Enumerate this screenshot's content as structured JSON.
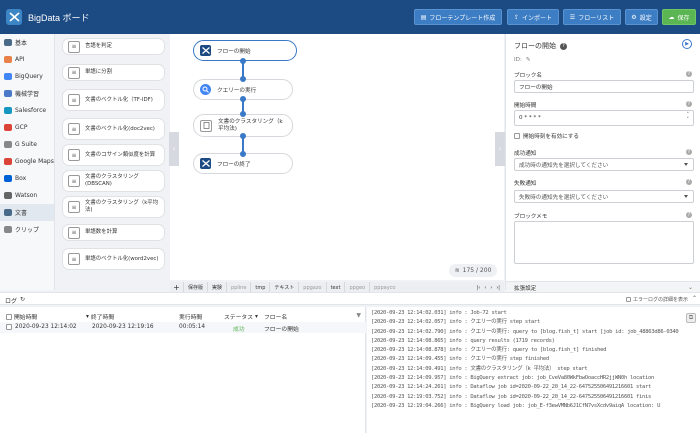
{
  "app": {
    "title": "BigData ボード"
  },
  "toolbar": {
    "template": "フローテンプレート作成",
    "import": "インポート",
    "flowlist": "フローリスト",
    "settings": "設定",
    "save": "保存"
  },
  "sidebar": {
    "items": [
      {
        "label": "基本",
        "icon": "gear-icon",
        "color": "#4a6a8a"
      },
      {
        "label": "API",
        "icon": "api-icon",
        "color": "#e8804a"
      },
      {
        "label": "BigQuery",
        "icon": "bigquery-icon",
        "color": "#4285f4"
      },
      {
        "label": "機械学習",
        "icon": "ml-icon",
        "color": "#4a7ac8"
      },
      {
        "label": "Salesforce",
        "icon": "salesforce-icon",
        "color": "#1798c1"
      },
      {
        "label": "GCP",
        "icon": "gcp-icon",
        "color": "#db4437"
      },
      {
        "label": "G Suite",
        "icon": "gsuite-icon",
        "color": "#888888"
      },
      {
        "label": "Google Maps",
        "icon": "maps-icon",
        "color": "#db4437"
      },
      {
        "label": "Box",
        "icon": "box-icon",
        "color": "#0061d5"
      },
      {
        "label": "Watson",
        "icon": "watson-icon",
        "color": "#666666"
      },
      {
        "label": "文書",
        "icon": "document-icon",
        "color": "#4a6a8a"
      },
      {
        "label": "クリップ",
        "icon": "clip-icon",
        "color": "#888888"
      }
    ]
  },
  "palette": {
    "items": [
      "言語を判定",
      "単語に分割",
      "文書のベクトル化（TF-IDF)",
      "文書のベクトル化(doc2vec)",
      "文書のコサイン類似度を計算",
      "文書のクラスタリング(DBSCAN)",
      "文書のクラスタリング（k平均法)",
      "単語数を計算",
      "単語のベクトル化(word2vec)"
    ]
  },
  "canvas": {
    "nodes": [
      "フローの開始",
      "クエリーの実行",
      "文書のクラスタリング（k平均法)",
      "フローの終了"
    ],
    "counter": "175 / 200"
  },
  "tabs": [
    "保存版",
    "実験",
    "ppline",
    "tmp",
    "テキスト",
    "ppgazo",
    "text",
    "ppgeo",
    "pppayco"
  ],
  "panel": {
    "title": "フローの開始",
    "id_label": "ID:",
    "block_name_label": "ブロック名",
    "block_name_value": "フローの開始",
    "start_time_label": "開始時間",
    "start_time_value": "0 * * * *",
    "enable_start_time": "開始時刻を有効にする",
    "success_label": "成功通知",
    "success_placeholder": "成功時の通知先を選択してください",
    "failure_label": "失敗通知",
    "failure_placeholder": "失敗時の通知先を選択してください",
    "memo_label": "ブロックメモ",
    "extension": "拡張設定"
  },
  "log": {
    "title": "ログ",
    "error_detail": "エラーログの詳細を表示",
    "headers": {
      "start": "開始時間",
      "end": "終了時間",
      "exec": "実行時間",
      "status": "ステータス",
      "flow": "フロー名"
    },
    "rows": [
      {
        "start": "2020-09-23 12:14:02",
        "end": "2020-09-23 12:19:16",
        "exec": "00:05:14",
        "status": "成功",
        "flow": "フローの開始"
      }
    ],
    "lines": [
      "[2020-09-23 12:14:02.031] info : Job-72 start",
      "[2020-09-23 12:14:02.057] info : クエリーの実行 step start",
      "[2020-09-23 12:14:02.790] info : クエリーの実行: query to [blog.fish_t] start [job id: job_48863d86-0340",
      "[2020-09-23 12:14:08.865] info : query results (1719 records)",
      "[2020-09-23 12:14:08.878] info : クエリーの実行: query to [blog.fish_t] finished",
      "[2020-09-23 12:14:09.455] info : クエリーの実行 step finished",
      "[2020-09-23 12:14:09.491] info : 文書のクラスタリング（k 平均法） step start",
      "[2020-09-23 12:14:09.957] info : BigQuery extract job: job_CveVa80WkFbwOoaccHR2jjWN0h location",
      "[2020-09-23 12:14:24.261] info : Dataflow job id=2020-09-22_20_14_22-647525506491216601 start",
      "[2020-09-23 12:19:03.752] info : Dataflow job id=2020-09-22_20_14_22-647525506491216601 finis",
      "[2020-09-23 12:19:04.266] info : BigQuery load job: job_E-f3ewVMNb6J1CfN7vsXcdv9aiqA location: U"
    ]
  }
}
